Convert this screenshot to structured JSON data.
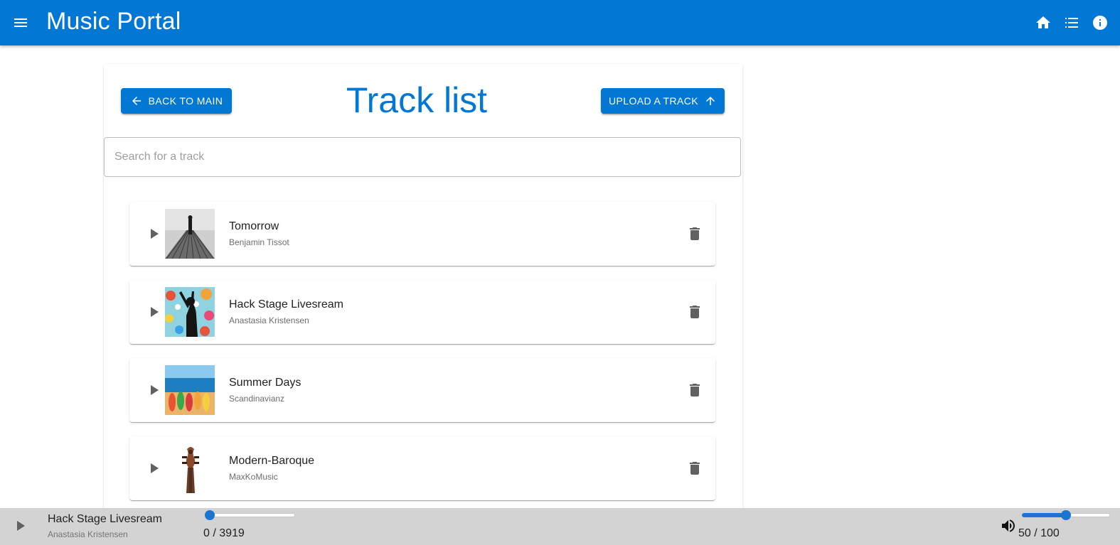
{
  "app": {
    "title": "Music Portal",
    "brand_color": "#0277d4",
    "icons": [
      "menu-icon",
      "home-icon",
      "list-icon",
      "info-icon"
    ]
  },
  "page": {
    "title": "Track list",
    "back_button": "BACK TO MAIN",
    "upload_button": "UPLOAD A TRACK",
    "search_placeholder": "Search for a track",
    "search_value": ""
  },
  "tracks": [
    {
      "name": "Tomorrow",
      "artist": "Benjamin Tissot",
      "cover": "pier-silhouette"
    },
    {
      "name": "Hack Stage Livesream",
      "artist": "Anastasia Kristensen",
      "cover": "colorful-dancer"
    },
    {
      "name": "Summer Days",
      "artist": "Scandinavianz",
      "cover": "beach-flipflops"
    },
    {
      "name": "Modern-Baroque",
      "artist": "MaxKoMusic",
      "cover": "violin-scroll"
    }
  ],
  "player": {
    "track_name": "Hack Stage Livesream",
    "track_artist": "Anastasia Kristensen",
    "time_text": "0 / 3919",
    "position": 0,
    "duration": 3919,
    "volume_text": "50 / 100",
    "volume": 50,
    "volume_max": 100,
    "background": "#d3d3d3"
  }
}
